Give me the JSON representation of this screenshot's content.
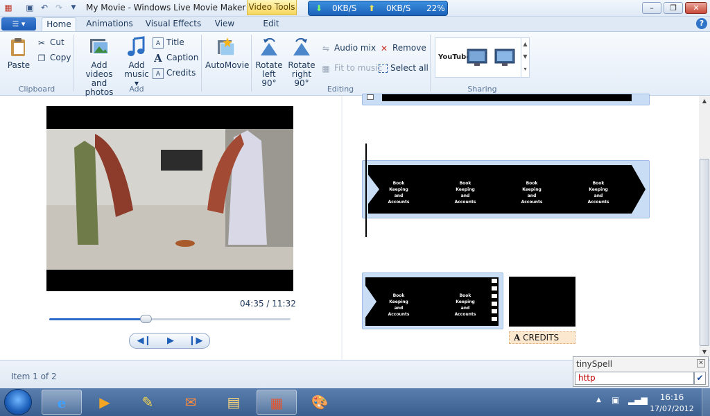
{
  "window": {
    "title": "My Movie - Windows Live Movie Maker",
    "contextual_tab": "Video Tools",
    "controls": {
      "minimize": "–",
      "maximize": "❐",
      "close": "✕"
    }
  },
  "net_meter": {
    "down": "0KB/S",
    "up": "0KB/S",
    "percent": "22%"
  },
  "tabs": [
    {
      "label": "Home"
    },
    {
      "label": "Animations"
    },
    {
      "label": "Visual Effects"
    },
    {
      "label": "View"
    },
    {
      "label": "Edit"
    }
  ],
  "ribbon": {
    "clipboard": {
      "label": "Clipboard",
      "paste": "Paste",
      "cut": "Cut",
      "copy": "Copy"
    },
    "add": {
      "label": "Add",
      "add_videos_line1": "Add videos",
      "add_videos_line2": "and photos",
      "add_music_line1": "Add",
      "add_music_line2": "music",
      "title": "Title",
      "caption": "Caption",
      "credits": "Credits"
    },
    "automovie": "AutoMovie",
    "editing": {
      "label": "Editing",
      "rotate_left_line1": "Rotate",
      "rotate_left_line2": "left 90°",
      "rotate_right_line1": "Rotate",
      "rotate_right_line2": "right 90°",
      "audio_mix": "Audio mix",
      "fit_to_music": "Fit to music",
      "remove": "Remove",
      "select_all": "Select all"
    },
    "sharing": {
      "label": "Sharing",
      "youtube": "YouTube"
    }
  },
  "preview": {
    "time": "04:35 / 11:32",
    "progress": 0.4
  },
  "storyboard": {
    "frame_line1": "Book",
    "frame_line2": "Keeping",
    "frame_line3": "and",
    "frame_line4": "Accounts",
    "credits_caption": "CREDITS"
  },
  "status": {
    "text": "Item 1 of 2"
  },
  "tinyspell": {
    "title": "tinySpell",
    "input_value": "http"
  },
  "taskbar": {
    "time": "16:16",
    "date": "17/07/2012"
  }
}
